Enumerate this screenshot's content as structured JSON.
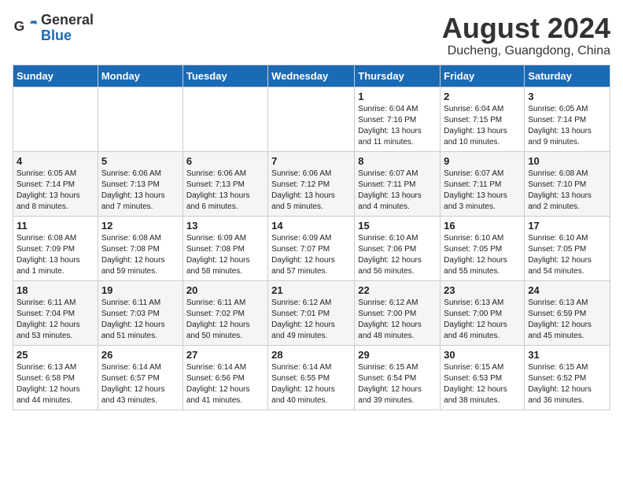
{
  "logo": {
    "general": "General",
    "blue": "Blue"
  },
  "title": {
    "month_year": "August 2024",
    "location": "Ducheng, Guangdong, China"
  },
  "weekdays": [
    "Sunday",
    "Monday",
    "Tuesday",
    "Wednesday",
    "Thursday",
    "Friday",
    "Saturday"
  ],
  "weeks": [
    [
      {
        "day": "",
        "info": ""
      },
      {
        "day": "",
        "info": ""
      },
      {
        "day": "",
        "info": ""
      },
      {
        "day": "",
        "info": ""
      },
      {
        "day": "1",
        "info": "Sunrise: 6:04 AM\nSunset: 7:16 PM\nDaylight: 13 hours\nand 11 minutes."
      },
      {
        "day": "2",
        "info": "Sunrise: 6:04 AM\nSunset: 7:15 PM\nDaylight: 13 hours\nand 10 minutes."
      },
      {
        "day": "3",
        "info": "Sunrise: 6:05 AM\nSunset: 7:14 PM\nDaylight: 13 hours\nand 9 minutes."
      }
    ],
    [
      {
        "day": "4",
        "info": "Sunrise: 6:05 AM\nSunset: 7:14 PM\nDaylight: 13 hours\nand 8 minutes."
      },
      {
        "day": "5",
        "info": "Sunrise: 6:06 AM\nSunset: 7:13 PM\nDaylight: 13 hours\nand 7 minutes."
      },
      {
        "day": "6",
        "info": "Sunrise: 6:06 AM\nSunset: 7:13 PM\nDaylight: 13 hours\nand 6 minutes."
      },
      {
        "day": "7",
        "info": "Sunrise: 6:06 AM\nSunset: 7:12 PM\nDaylight: 13 hours\nand 5 minutes."
      },
      {
        "day": "8",
        "info": "Sunrise: 6:07 AM\nSunset: 7:11 PM\nDaylight: 13 hours\nand 4 minutes."
      },
      {
        "day": "9",
        "info": "Sunrise: 6:07 AM\nSunset: 7:11 PM\nDaylight: 13 hours\nand 3 minutes."
      },
      {
        "day": "10",
        "info": "Sunrise: 6:08 AM\nSunset: 7:10 PM\nDaylight: 13 hours\nand 2 minutes."
      }
    ],
    [
      {
        "day": "11",
        "info": "Sunrise: 6:08 AM\nSunset: 7:09 PM\nDaylight: 13 hours\nand 1 minute."
      },
      {
        "day": "12",
        "info": "Sunrise: 6:08 AM\nSunset: 7:08 PM\nDaylight: 12 hours\nand 59 minutes."
      },
      {
        "day": "13",
        "info": "Sunrise: 6:09 AM\nSunset: 7:08 PM\nDaylight: 12 hours\nand 58 minutes."
      },
      {
        "day": "14",
        "info": "Sunrise: 6:09 AM\nSunset: 7:07 PM\nDaylight: 12 hours\nand 57 minutes."
      },
      {
        "day": "15",
        "info": "Sunrise: 6:10 AM\nSunset: 7:06 PM\nDaylight: 12 hours\nand 56 minutes."
      },
      {
        "day": "16",
        "info": "Sunrise: 6:10 AM\nSunset: 7:05 PM\nDaylight: 12 hours\nand 55 minutes."
      },
      {
        "day": "17",
        "info": "Sunrise: 6:10 AM\nSunset: 7:05 PM\nDaylight: 12 hours\nand 54 minutes."
      }
    ],
    [
      {
        "day": "18",
        "info": "Sunrise: 6:11 AM\nSunset: 7:04 PM\nDaylight: 12 hours\nand 53 minutes."
      },
      {
        "day": "19",
        "info": "Sunrise: 6:11 AM\nSunset: 7:03 PM\nDaylight: 12 hours\nand 51 minutes."
      },
      {
        "day": "20",
        "info": "Sunrise: 6:11 AM\nSunset: 7:02 PM\nDaylight: 12 hours\nand 50 minutes."
      },
      {
        "day": "21",
        "info": "Sunrise: 6:12 AM\nSunset: 7:01 PM\nDaylight: 12 hours\nand 49 minutes."
      },
      {
        "day": "22",
        "info": "Sunrise: 6:12 AM\nSunset: 7:00 PM\nDaylight: 12 hours\nand 48 minutes."
      },
      {
        "day": "23",
        "info": "Sunrise: 6:13 AM\nSunset: 7:00 PM\nDaylight: 12 hours\nand 46 minutes."
      },
      {
        "day": "24",
        "info": "Sunrise: 6:13 AM\nSunset: 6:59 PM\nDaylight: 12 hours\nand 45 minutes."
      }
    ],
    [
      {
        "day": "25",
        "info": "Sunrise: 6:13 AM\nSunset: 6:58 PM\nDaylight: 12 hours\nand 44 minutes."
      },
      {
        "day": "26",
        "info": "Sunrise: 6:14 AM\nSunset: 6:57 PM\nDaylight: 12 hours\nand 43 minutes."
      },
      {
        "day": "27",
        "info": "Sunrise: 6:14 AM\nSunset: 6:56 PM\nDaylight: 12 hours\nand 41 minutes."
      },
      {
        "day": "28",
        "info": "Sunrise: 6:14 AM\nSunset: 6:55 PM\nDaylight: 12 hours\nand 40 minutes."
      },
      {
        "day": "29",
        "info": "Sunrise: 6:15 AM\nSunset: 6:54 PM\nDaylight: 12 hours\nand 39 minutes."
      },
      {
        "day": "30",
        "info": "Sunrise: 6:15 AM\nSunset: 6:53 PM\nDaylight: 12 hours\nand 38 minutes."
      },
      {
        "day": "31",
        "info": "Sunrise: 6:15 AM\nSunset: 6:52 PM\nDaylight: 12 hours\nand 36 minutes."
      }
    ]
  ]
}
